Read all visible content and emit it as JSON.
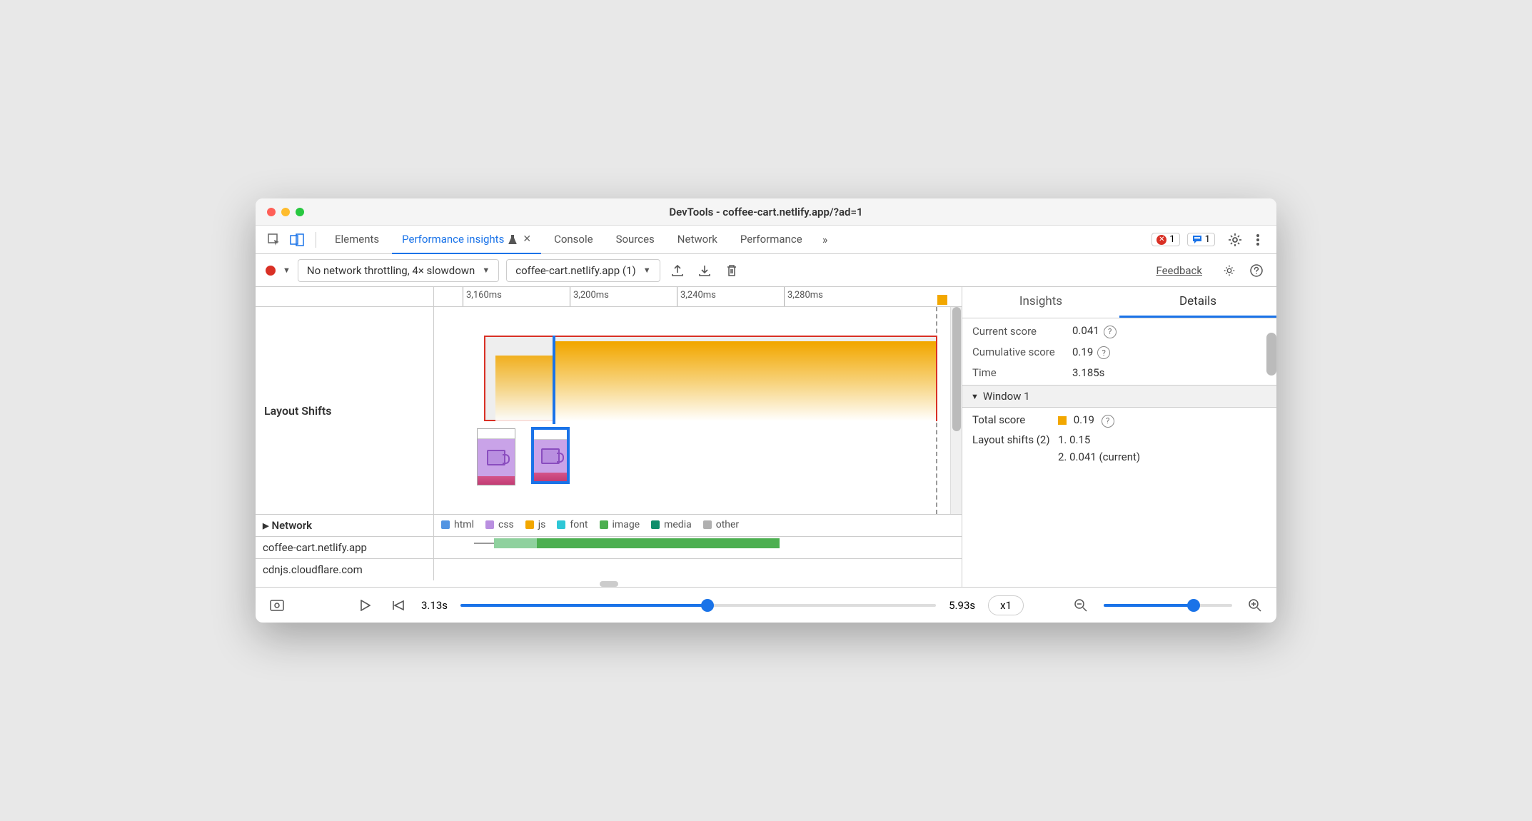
{
  "window": {
    "title": "DevTools - coffee-cart.netlify.app/?ad=1"
  },
  "tabs": {
    "items": [
      "Elements",
      "Performance insights",
      "Console",
      "Sources",
      "Network",
      "Performance"
    ],
    "active_index": 1
  },
  "badges": {
    "error_count": "1",
    "messages_count": "1"
  },
  "toolbar": {
    "throttle": "No network throttling, 4× slowdown",
    "recording": "coffee-cart.netlify.app (1)",
    "feedback": "Feedback"
  },
  "ruler": {
    "ticks": [
      "3,160ms",
      "3,200ms",
      "3,240ms",
      "3,280ms"
    ]
  },
  "tracks": {
    "layout_shifts": "Layout Shifts",
    "network_header": "Network",
    "network_hosts": [
      "coffee-cart.netlify.app",
      "cdnjs.cloudflare.com"
    ]
  },
  "legend": {
    "html": "html",
    "css": "css",
    "js": "js",
    "font": "font",
    "image": "image",
    "media": "media",
    "other": "other"
  },
  "right": {
    "tabs": {
      "insights": "Insights",
      "details": "Details"
    },
    "current_score_label": "Current score",
    "current_score_value": "0.041",
    "cumulative_label": "Cumulative score",
    "cumulative_value": "0.19",
    "time_label": "Time",
    "time_value": "3.185s",
    "window_header": "Window 1",
    "total_score_label": "Total score",
    "total_score_value": "0.19",
    "layout_shifts_label": "Layout shifts (2)",
    "shift1": "1. 0.15",
    "shift2": "2. 0.041 (current)"
  },
  "playback": {
    "start": "3.13s",
    "end": "5.93s",
    "speed": "x1"
  }
}
